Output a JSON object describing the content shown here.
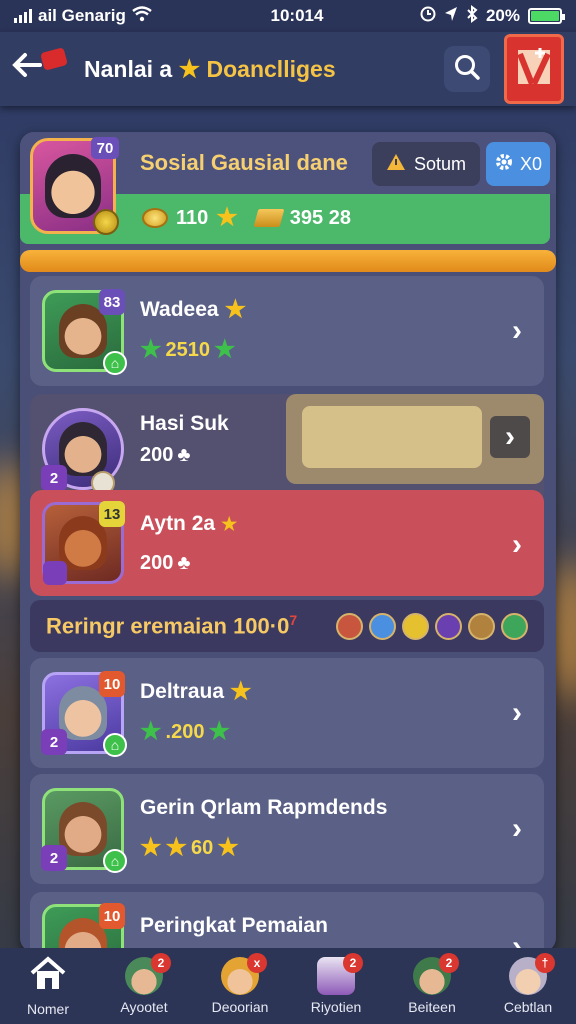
{
  "status_bar": {
    "carrier": "ail Genarig",
    "time": "10:014",
    "battery": "20%"
  },
  "header": {
    "title_part1": "Nanlai a",
    "title_part2": "Doanclliges"
  },
  "profile": {
    "name": "Sosial Gausial dane",
    "level": "70",
    "coins": "110",
    "gold": "395 28",
    "action_button": "Sotum",
    "icon_button": "X0"
  },
  "players": [
    {
      "name": "Wadeea",
      "score": "2510",
      "badge": "83",
      "color": "#2f8f47"
    },
    {
      "name": "Hasi Suk",
      "score": "200",
      "badge": "2",
      "color": "#6a4a8e"
    },
    {
      "name": "Aytn 2a",
      "score": "200",
      "badge": "13",
      "color": "#8a3f2a"
    }
  ],
  "section": {
    "title": "Reringr eremaian 100·0",
    "superscript": "7"
  },
  "players2": [
    {
      "name": "Deltraua",
      "score": ".200",
      "badge": "10",
      "level": "2"
    },
    {
      "name": "Gerin Qrlam Rapmdends",
      "score": "60",
      "level": "2"
    },
    {
      "name": "Peringkat Pemaian",
      "badge": "10"
    }
  ],
  "nav": [
    {
      "label": "Nomer",
      "icon": "home-icon"
    },
    {
      "label": "Ayootet",
      "badge": "2",
      "icon": "avatar-icon"
    },
    {
      "label": "Deoorian",
      "badge": "x",
      "icon": "avatar-icon"
    },
    {
      "label": "Riyotien",
      "badge": "2",
      "icon": "shop-icon"
    },
    {
      "label": "Beiteen",
      "badge": "2",
      "icon": "avatar-icon"
    },
    {
      "label": "Cebtlan",
      "badge": "†",
      "icon": "avatar-icon"
    }
  ],
  "colors": {
    "accent": "#f6c445",
    "green": "#4bb86a",
    "red_row": "#c9505a",
    "panel": "#4a4f78"
  }
}
